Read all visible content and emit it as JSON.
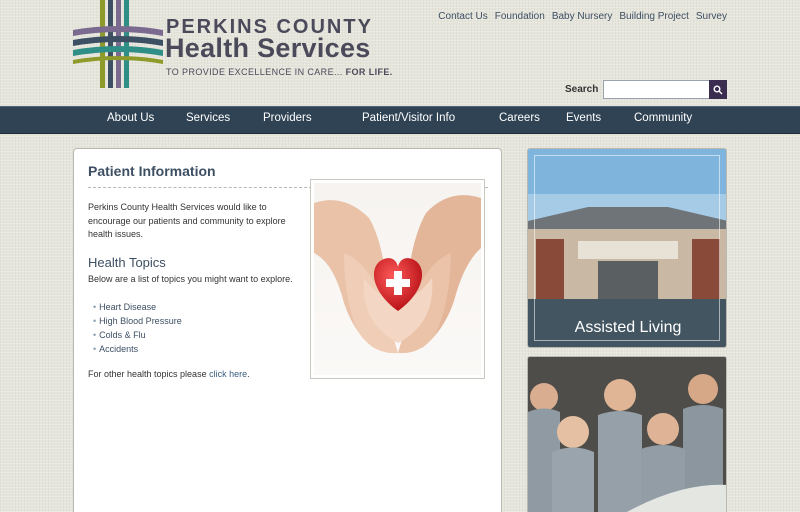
{
  "header": {
    "logo_line1": "PERKINS COUNTY",
    "logo_line2": "Health Services",
    "tagline_a": "TO PROVIDE EXCELLENCE IN CARE...",
    "tagline_b": "FOR LIFE."
  },
  "top_links": [
    "Contact Us",
    "Foundation",
    "Baby Nursery",
    "Building Project",
    "Survey"
  ],
  "search": {
    "label": "Search",
    "placeholder": ""
  },
  "nav": [
    "About Us",
    "Services",
    "Providers",
    "Patient/Visitor Info",
    "Careers",
    "Events",
    "Community"
  ],
  "main": {
    "title": "Patient Information",
    "intro": "Perkins County Health Services would like to encourage our patients and community to explore health issues.",
    "topics_heading": "Health Topics",
    "topics_sub": "Below are a list of topics you might want to explore.",
    "topics": [
      "Heart Disease",
      "High Blood Pressure",
      "Colds & Flu",
      "Accidents"
    ],
    "other_prefix": "For other health topics please ",
    "other_link": "click here",
    "other_suffix": "."
  },
  "sidebar": {
    "card1_label": "Assisted Living"
  },
  "colors": {
    "nav_bg": "#2f4354",
    "accent": "#3d4f63",
    "search_btn": "#3b2d4f"
  }
}
